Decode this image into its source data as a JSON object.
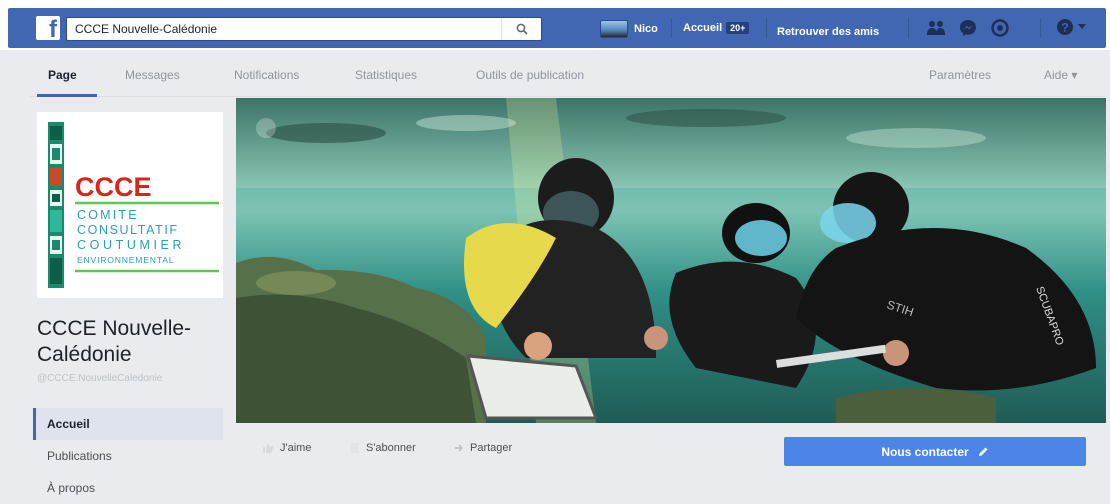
{
  "topbar": {
    "search_value": "CCCE Nouvelle-Calédonie",
    "profile_name": "Nico",
    "home_label": "Accueil",
    "home_badge": "20+",
    "find_friends_label": "Retrouver des amis",
    "colors": {
      "brand": "#4267b2",
      "accent_button": "#4c84e8"
    },
    "icons": [
      "facebook-logo-icon",
      "search-icon",
      "friend-requests-icon",
      "messages-icon",
      "notifications-icon",
      "help-icon",
      "dropdown-arrow-icon"
    ]
  },
  "page_tabs": [
    {
      "label": "Page",
      "active": true
    },
    {
      "label": "Messages",
      "active": false
    },
    {
      "label": "Notifications",
      "active": false
    },
    {
      "label": "Statistiques",
      "active": false
    },
    {
      "label": "Outils de publication",
      "active": false
    }
  ],
  "page_tabs_right": {
    "settings_label": "Paramètres",
    "help_label": "Aide ▾"
  },
  "logo": {
    "acronym": "CCCE",
    "line1": "COMITE",
    "line2": "CONSULTATIF",
    "line3": "COUTUMIER",
    "line4": "ENVIRONNEMENTAL"
  },
  "page": {
    "name_line1": "CCCE Nouvelle-",
    "name_line2": "Calédonie",
    "handle": "@CCCE.NouvelleCaledonie"
  },
  "left_nav": [
    {
      "label": "Accueil",
      "active": true
    },
    {
      "label": "Publications",
      "active": false
    },
    {
      "label": "À propos",
      "active": false
    }
  ],
  "actions": {
    "like_label": "J'aime",
    "follow_label": "S'abonner",
    "share_label": "Partager",
    "contact_label": "Nous contacter"
  }
}
